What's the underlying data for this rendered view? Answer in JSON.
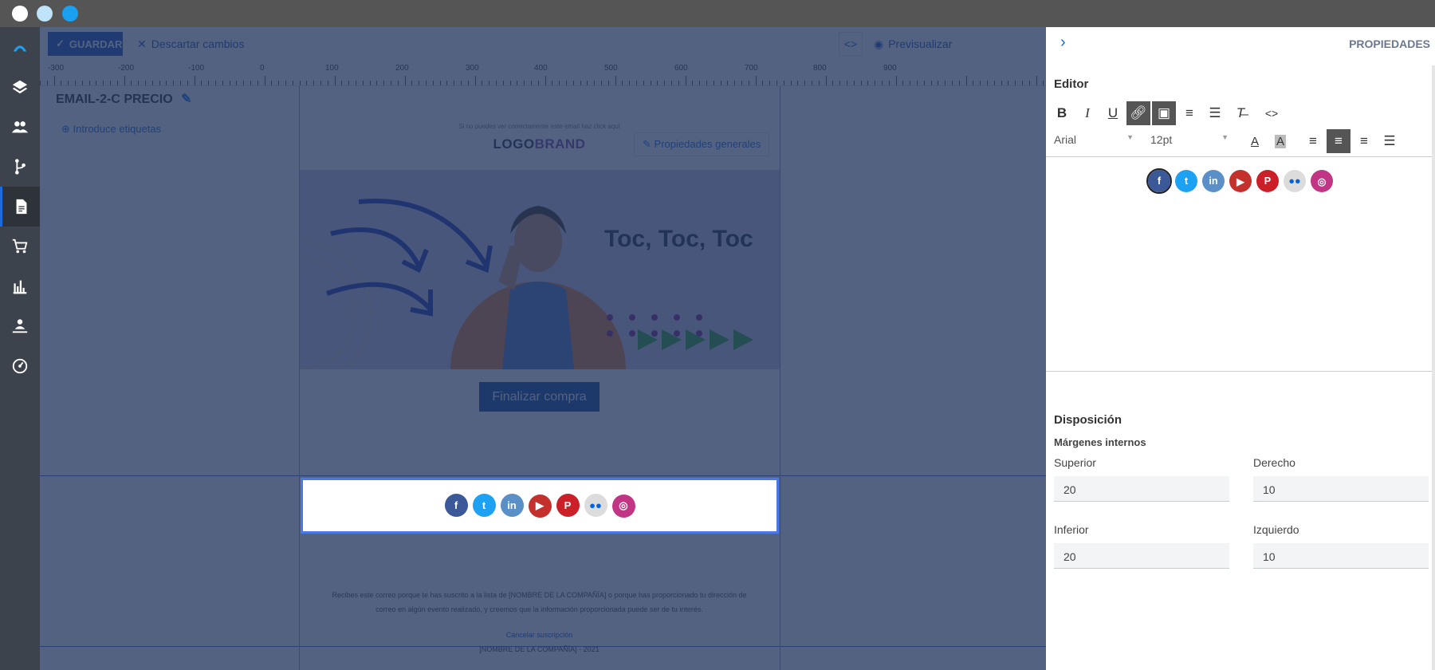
{
  "toolbar": {
    "save_label": "GUARDAR",
    "discard_label": "Descartar cambios",
    "code_label": "<>",
    "preview_label": "Previsualizar"
  },
  "ruler": {
    "labels": [
      "-300",
      "-200",
      "-100",
      "0",
      "100",
      "200",
      "300",
      "400",
      "500",
      "600",
      "700",
      "800",
      "900"
    ]
  },
  "template": {
    "name": "EMAIL-2-C PRECIO",
    "tags_label": "Introduce etiquetas",
    "general_props_label": "Propiedades generales"
  },
  "email": {
    "preheader": "Si no puedes ver correctamente este email haz click aquí",
    "logo_part1": "LOGO",
    "logo_part2": "BRAND",
    "hero_title": "Toc, Toc, Toc",
    "cta_label": "Finalizar compra",
    "footer_text_1": "Recibes este correo porque te has suscrito a la lista de [NOMBRE DE LA COMPAÑÍA] o porque has proporcionado tu dirección de",
    "footer_text_2": "correo en algún evento realizado, y creemos que la información proporcionada puede ser de tu interés.",
    "unsubscribe_label": "Cancelar suscripción",
    "copyright": "[NOMBRE DE LA COMPAÑÍA] - 2021"
  },
  "social_icons": [
    {
      "name": "facebook-icon",
      "glyph": "f",
      "color": "#3b5998"
    },
    {
      "name": "twitter-icon",
      "glyph": "t",
      "color": "#1da1f2"
    },
    {
      "name": "linkedin-icon",
      "glyph": "in",
      "color": "#5b8fc7"
    },
    {
      "name": "youtube-icon",
      "glyph": "▶",
      "color": "#c4302b"
    },
    {
      "name": "pinterest-icon",
      "glyph": "P",
      "color": "#cb2027"
    },
    {
      "name": "flickr-icon",
      "glyph": "●●",
      "color": "#dcdcdc"
    },
    {
      "name": "instagram-icon",
      "glyph": "◎",
      "color": "#c13584"
    }
  ],
  "panel": {
    "title": "PROPIEDADES",
    "editor_label": "Editor",
    "font_name": "Arial",
    "font_size": "12pt",
    "layout_label": "Disposición",
    "padding_label": "Márgenes internos",
    "fields": {
      "top_label": "Superior",
      "top_value": "20",
      "right_label": "Derecho",
      "right_value": "10",
      "bottom_label": "Inferior",
      "bottom_value": "20",
      "left_label": "Izquierdo",
      "left_value": "10"
    }
  },
  "colors": {
    "accent": "#1a6be0",
    "sidebar": "#3d434c",
    "overlay": "#23365c",
    "cta": "#0a3fa0",
    "logo_brand": "#7b3fa0"
  }
}
